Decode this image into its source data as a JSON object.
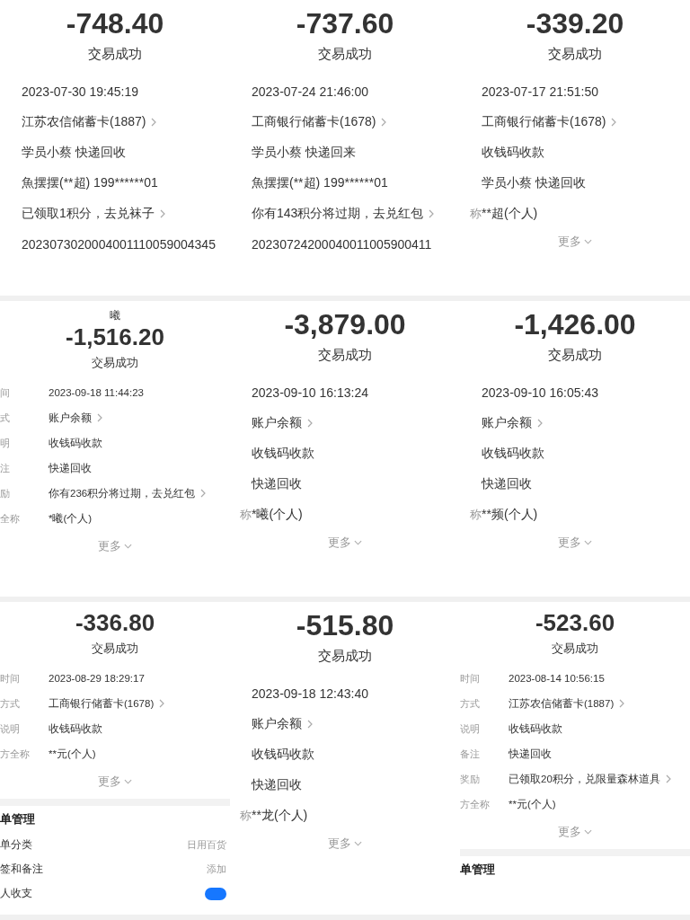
{
  "panels": [
    {
      "kind": "normal",
      "amount": "-748.40",
      "status": "交易成功",
      "rows": [
        {
          "value": "2023-07-30 19:45:19",
          "link": false
        },
        {
          "value": "江苏农信储蓄卡(1887)",
          "link": true
        },
        {
          "value": "学员小蔡 快递回收",
          "link": false
        },
        {
          "value": "魚摆摆(**超) 199******01",
          "link": false
        },
        {
          "value": "已领取1积分，去兑袜子",
          "link": true
        },
        {
          "value": "2023073020004001110059004345",
          "link": false
        }
      ]
    },
    {
      "kind": "normal",
      "amount": "-737.60",
      "status": "交易成功",
      "rows": [
        {
          "value": "2023-07-24 21:46:00",
          "link": false
        },
        {
          "value": "工商银行储蓄卡(1678)",
          "link": true
        },
        {
          "value": "学员小蔡 快递回来",
          "link": false
        },
        {
          "value": "魚摆摆(**超) 199******01",
          "link": false
        },
        {
          "value": "你有143积分将过期，去兑红包",
          "link": true
        },
        {
          "value": "20230724200040011005900411",
          "link": false
        }
      ]
    },
    {
      "kind": "normal",
      "amount": "-339.20",
      "status": "交易成功",
      "rows": [
        {
          "value": "2023-07-17 21:51:50",
          "link": false
        },
        {
          "value": "工商银行储蓄卡(1678)",
          "link": true
        },
        {
          "value": "收钱码收款",
          "link": false
        },
        {
          "value": "学员小蔡 快递回收",
          "link": false
        },
        {
          "label": "称",
          "value": "**超(个人)",
          "link": false
        }
      ],
      "more": "更多"
    },
    {
      "kind": "compact",
      "top": "曦",
      "amount": "-1,516.20",
      "status": "交易成功",
      "rows": [
        {
          "label": "间",
          "value": "2023-09-18 11:44:23",
          "link": false
        },
        {
          "label": "式",
          "value": "账户余额",
          "link": true
        },
        {
          "label": "明",
          "value": "收钱码收款",
          "link": false
        },
        {
          "label": "注",
          "value": "快递回收",
          "link": false
        },
        {
          "label": "励",
          "value": "你有236积分将过期，去兑红包",
          "link": true
        },
        {
          "label": "全称",
          "value": "*曦(个人)",
          "link": false
        }
      ],
      "more": "更多"
    },
    {
      "kind": "normal",
      "amount": "-3,879.00",
      "status": "交易成功",
      "rows": [
        {
          "value": "2023-09-10 16:13:24",
          "link": false
        },
        {
          "value": "账户余额",
          "link": true
        },
        {
          "value": "收钱码收款",
          "link": false
        },
        {
          "value": "快递回收",
          "link": false
        },
        {
          "label": "称",
          "value": "*曦(个人)",
          "link": false
        }
      ],
      "more": "更多"
    },
    {
      "kind": "normal",
      "amount": "-1,426.00",
      "status": "交易成功",
      "rows": [
        {
          "value": "2023-09-10 16:05:43",
          "link": false
        },
        {
          "value": "账户余额",
          "link": true
        },
        {
          "value": "收钱码收款",
          "link": false
        },
        {
          "value": "快递回收",
          "link": false
        },
        {
          "label": "称",
          "value": "**频(个人)",
          "link": false
        }
      ],
      "more": "更多"
    },
    {
      "kind": "compact",
      "amount": "-336.80",
      "status": "交易成功",
      "rows": [
        {
          "label": "时间",
          "value": "2023-08-29 18:29:17",
          "link": false
        },
        {
          "label": "方式",
          "value": "工商银行储蓄卡(1678)",
          "link": true
        },
        {
          "label": "说明",
          "value": "收钱码收款",
          "link": false
        },
        {
          "label": "方全称",
          "value": "**元(个人)",
          "link": false
        }
      ],
      "more": "更多",
      "section": {
        "title": "单管理",
        "items": [
          {
            "kind": "text",
            "label": "单分类",
            "value": "日用百货"
          },
          {
            "kind": "text",
            "label": "签和备注",
            "value": "添加"
          },
          {
            "kind": "toggle",
            "label": "人收支",
            "on": true
          }
        ]
      }
    },
    {
      "kind": "normal",
      "amount": "-515.80",
      "status": "交易成功",
      "rows": [
        {
          "value": "2023-09-18 12:43:40",
          "link": false
        },
        {
          "value": "账户余额",
          "link": true
        },
        {
          "value": "收钱码收款",
          "link": false
        },
        {
          "value": "快递回收",
          "link": false
        },
        {
          "label": "称",
          "value": "**龙(个人)",
          "link": false
        }
      ],
      "more": "更多"
    },
    {
      "kind": "compact",
      "amount": "-523.60",
      "status": "交易成功",
      "rows": [
        {
          "label": "时间",
          "value": "2023-08-14 10:56:15",
          "link": false
        },
        {
          "label": "方式",
          "value": "江苏农信储蓄卡(1887)",
          "link": true
        },
        {
          "label": "说明",
          "value": "收钱码收款",
          "link": false
        },
        {
          "label": "备注",
          "value": "快递回收",
          "link": false
        },
        {
          "label": "奖励",
          "value": "已领取20积分，兑限量森林道具",
          "link": true
        },
        {
          "label": "方全称",
          "value": "**元(个人)",
          "link": false
        }
      ],
      "more": "更多",
      "section": {
        "title": "单管理"
      }
    }
  ]
}
